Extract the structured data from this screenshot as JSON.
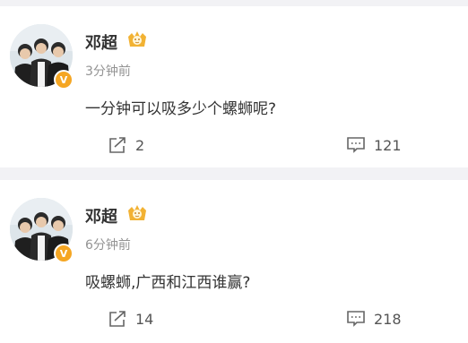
{
  "colors": {
    "page_bg": "#f2f2f5",
    "card_bg": "#ffffff",
    "name": "#333333",
    "meta": "#939393",
    "verified_badge": "#f5a623"
  },
  "posts": [
    {
      "author": "邓超",
      "time": "3分钟前",
      "text": "一分钟可以吸多少个螺蛳呢?",
      "verified_mark": "V",
      "reposts": "2",
      "comments": "121"
    },
    {
      "author": "邓超",
      "time": "6分钟前",
      "text": "吸螺蛳,广西和江西谁赢?",
      "verified_mark": "V",
      "reposts": "14",
      "comments": "218"
    }
  ],
  "icons": {
    "level": "vip-level-icon",
    "repost": "repost-icon",
    "comment": "comment-icon",
    "verified": "verified-badge-icon"
  }
}
